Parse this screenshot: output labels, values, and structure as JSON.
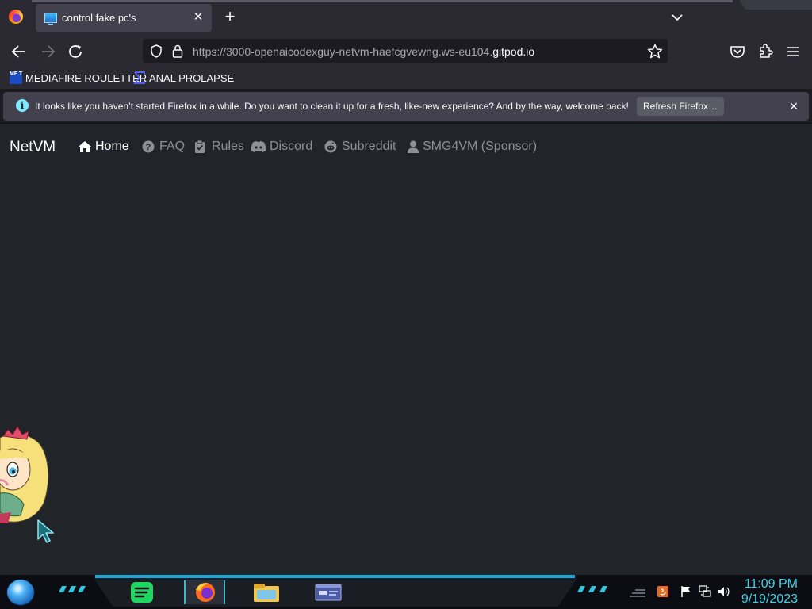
{
  "browser": {
    "tab": {
      "title": "control fake pc's"
    },
    "address": {
      "prefix": "https://3000-openaicodexguy-netvm-haefcgvewng.ws-eu104.",
      "host": "gitpod.io"
    },
    "bookmarks": [
      {
        "icon": "mediafire-icon",
        "icon_text": "MF T",
        "label": "MEDIAFIRE ROULETTER"
      },
      {
        "icon": "sigma-icon",
        "label": "ANAL PROLAPSE"
      }
    ],
    "notification": {
      "text": "It looks like you haven’t started Firefox in a while. Do you want to clean it up for a fresh, like-new experience? And by the way, welcome back!",
      "button": "Refresh Firefox…"
    }
  },
  "site": {
    "brand": "NetVM",
    "nav": [
      {
        "label": "Home",
        "icon": "home-icon",
        "active": true
      },
      {
        "label": "FAQ",
        "icon": "question-circle-icon",
        "active": false
      },
      {
        "label": "Rules",
        "icon": "clipboard-check-icon",
        "active": false
      },
      {
        "label": "Discord",
        "icon": "discord-icon",
        "active": false
      },
      {
        "label": "Subreddit",
        "icon": "reddit-icon",
        "active": false
      },
      {
        "label": "SMG4VM (Sponsor)",
        "icon": "user-icon",
        "active": false
      }
    ]
  },
  "taskbar": {
    "apps": [
      "spotify-icon",
      "firefox-icon",
      "file-explorer-icon",
      "window-app-icon"
    ],
    "active_app": "firefox-icon",
    "tray": [
      "show-hidden-icons-icon",
      "java-icon",
      "action-center-flag-icon",
      "network-icon",
      "volume-icon"
    ],
    "time": "11:09 PM",
    "date": "9/19/2023"
  },
  "colors": {
    "browser_chrome": "#2b2a33",
    "page_background": "#212529",
    "nav_active": "#ffffff",
    "nav_inactive": "#8d9196",
    "clock": "#3fd2e6",
    "taskbar_accent": "#1da7d6"
  }
}
